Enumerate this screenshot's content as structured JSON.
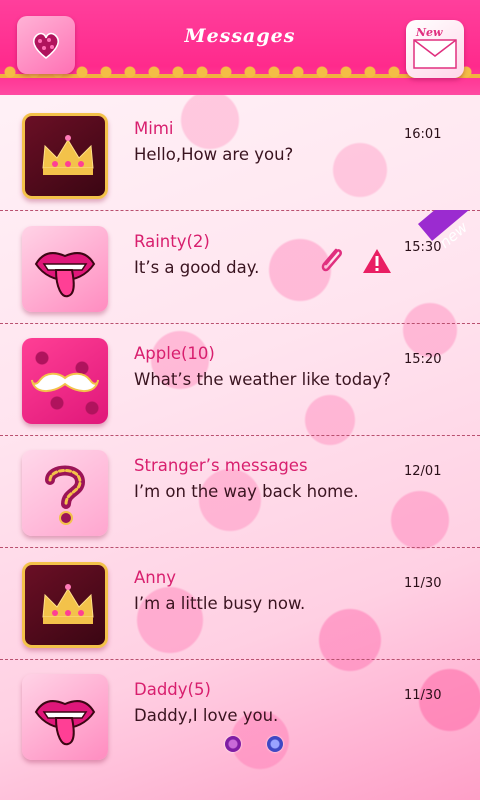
{
  "header": {
    "title": "Messages",
    "compose_label": "New"
  },
  "conversations": [
    {
      "name": "Mimi",
      "preview": "Hello,How are you?",
      "time": "16:01",
      "avatar": "crown-avatar"
    },
    {
      "name": "Rainty(2)",
      "preview": "It’s a good day.",
      "time": "15:30",
      "avatar": "lips-avatar",
      "ribbon": "new",
      "icons": [
        "paperclip-icon",
        "alert-icon"
      ]
    },
    {
      "name": "Apple(10)",
      "preview": "What’s the weather like today?",
      "time": "15:20",
      "avatar": "mustache-avatar"
    },
    {
      "name": "Stranger’s messages",
      "preview": "I’m on the way back home.",
      "time": "12/01",
      "avatar": "question-avatar"
    },
    {
      "name": "Anny",
      "preview": "I’m a little busy now.",
      "time": "11/30",
      "avatar": "crown-avatar"
    },
    {
      "name": "Daddy(5)",
      "preview": "Daddy,I love you.",
      "time": "11/30",
      "avatar": "lips-avatar"
    }
  ],
  "colors": {
    "header_pink": "#ff2a8c",
    "name_pink": "#d81f6e",
    "gold": "#f3c24a",
    "ribbon_purple": "#9b2bd0"
  }
}
